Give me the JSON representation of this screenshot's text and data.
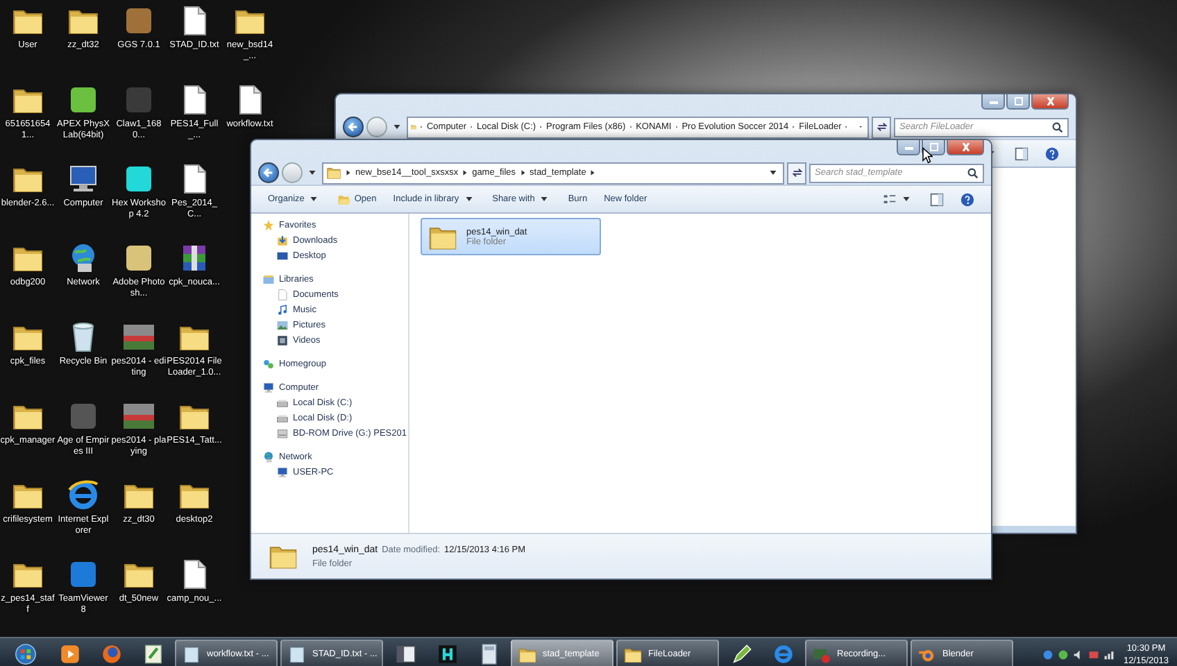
{
  "desktop": {
    "icon_rows": [
      [
        {
          "label": "User",
          "kind": "folder"
        },
        {
          "label": "zz_dt32",
          "kind": "folder"
        },
        {
          "label": "GGS 7.0.1",
          "kind": "app",
          "color": "#a0703a"
        },
        {
          "label": "STAD_ID.txt",
          "kind": "file"
        },
        {
          "label": "new_bsd14_...",
          "kind": "folder"
        }
      ],
      [
        {
          "label": "6516516541...",
          "kind": "folder"
        },
        {
          "label": "APEX PhysX Lab(64bit)",
          "kind": "app",
          "color": "#6cc040"
        },
        {
          "label": "Claw1_1680...",
          "kind": "app",
          "color": "#3a3a3a"
        },
        {
          "label": "PES14_Full_...",
          "kind": "file"
        },
        {
          "label": "workflow.txt",
          "kind": "file"
        }
      ],
      [
        {
          "label": "blender-2.6...",
          "kind": "folder"
        },
        {
          "label": "Computer",
          "kind": "computer"
        },
        {
          "label": "Hex Workshop 4.2",
          "kind": "app",
          "color": "#22d8d8"
        },
        {
          "label": "Pes_2014_C...",
          "kind": "file"
        }
      ],
      [
        {
          "label": "odbg200",
          "kind": "folder"
        },
        {
          "label": "Network",
          "kind": "network"
        },
        {
          "label": "Adobe Photosh...",
          "kind": "app",
          "color": "#d9c27a"
        },
        {
          "label": "cpk_nouca...",
          "kind": "archive"
        }
      ],
      [
        {
          "label": "cpk_files",
          "kind": "folder"
        },
        {
          "label": "Recycle Bin",
          "kind": "recycle"
        },
        {
          "label": "pes2014 - editing",
          "kind": "thumbnail"
        },
        {
          "label": "PES2014 File Loader_1.0...",
          "kind": "folder"
        }
      ],
      [
        {
          "label": "cpk_manager",
          "kind": "folder"
        },
        {
          "label": "Age of Empires III",
          "kind": "app",
          "color": "#555555"
        },
        {
          "label": "pes2014 - playing",
          "kind": "thumbnail"
        },
        {
          "label": "PES14_Tatt...",
          "kind": "folder"
        }
      ],
      [
        {
          "label": "crifilesystem",
          "kind": "folder"
        },
        {
          "label": "Internet Explorer",
          "kind": "browser"
        },
        {
          "label": "zz_dt30",
          "kind": "folder"
        },
        {
          "label": "desktop2",
          "kind": "folder"
        }
      ],
      [
        {
          "label": "z_pes14_staff",
          "kind": "folder"
        },
        {
          "label": "TeamViewer 8",
          "kind": "app",
          "color": "#1e7ad8"
        },
        {
          "label": "dt_50new",
          "kind": "folder"
        },
        {
          "label": "camp_nou_...",
          "kind": "file"
        }
      ]
    ]
  },
  "windows": [
    {
      "kind": "back",
      "address": [
        "Computer",
        "Local Disk (C:)",
        "Program Files (x86)",
        "KONAMI",
        "Pro Evolution Soccer 2014",
        "FileLoader"
      ],
      "search": {
        "placeholder": "Search FileLoader"
      }
    },
    {
      "kind": "front",
      "address": [
        "new_bse14__tool_sxsxsx",
        "game_files",
        "stad_template"
      ],
      "search": {
        "placeholder": "Search stad_template"
      },
      "toolbar": [
        {
          "label": "Organize",
          "kind": "menu"
        },
        {
          "label": "Open",
          "kind": "open"
        },
        {
          "label": "Include in library",
          "kind": "menu"
        },
        {
          "label": "Share with",
          "kind": "menu"
        },
        {
          "label": "Burn",
          "kind": "plain"
        },
        {
          "label": "New folder",
          "kind": "plain"
        }
      ],
      "sidebar": [
        {
          "label": "Favorites",
          "kind": "star",
          "children": [
            {
              "label": "Downloads",
              "kind": "downloads"
            },
            {
              "label": "Desktop",
              "kind": "desktop"
            }
          ]
        },
        {
          "label": "Libraries",
          "kind": "library",
          "children": [
            {
              "label": "Documents",
              "kind": "document"
            },
            {
              "label": "Music",
              "kind": "music"
            },
            {
              "label": "Pictures",
              "kind": "pictures"
            },
            {
              "label": "Videos",
              "kind": "videos"
            }
          ]
        },
        {
          "label": "Homegroup",
          "kind": "homegroup"
        },
        {
          "label": "Computer",
          "kind": "computer",
          "children": [
            {
              "label": "Local Disk (C:)",
              "kind": "disk"
            },
            {
              "label": "Local Disk (D:)",
              "kind": "disk"
            },
            {
              "label": "BD-ROM Drive (G:) PES201",
              "kind": "drive"
            }
          ]
        },
        {
          "label": "Network",
          "kind": "network",
          "children": [
            {
              "label": "USER-PC",
              "kind": "computer"
            }
          ]
        }
      ],
      "items": [
        {
          "name": "pes14_win_dat",
          "type": "File folder",
          "selected": true
        }
      ],
      "details": {
        "name": "pes14_win_dat",
        "date_label": "Date modified:",
        "date": "12/15/2013 4:16 PM",
        "type": "File folder"
      }
    }
  ],
  "taskbar": {
    "items": [
      {
        "kind": "start"
      },
      {
        "kind": "media"
      },
      {
        "kind": "firefox"
      },
      {
        "kind": "notepad"
      },
      {
        "kind": "doc",
        "label": "workflow.txt - ...",
        "selected": false
      },
      {
        "kind": "doc",
        "label": "STAD_ID.txt - ...",
        "selected": false
      },
      {
        "kind": "panel"
      },
      {
        "kind": "hex"
      },
      {
        "kind": "calc"
      },
      {
        "kind": "folder",
        "label": "stad_template",
        "selected": true
      },
      {
        "kind": "folder",
        "label": "FileLoader",
        "selected": false
      },
      {
        "kind": "pen"
      },
      {
        "kind": "ie"
      },
      {
        "kind": "record",
        "label": "Recording...",
        "selected": false
      },
      {
        "kind": "blender",
        "label": "Blender",
        "selected": false
      }
    ],
    "time": "10:30 PM",
    "date": "12/15/2013"
  }
}
